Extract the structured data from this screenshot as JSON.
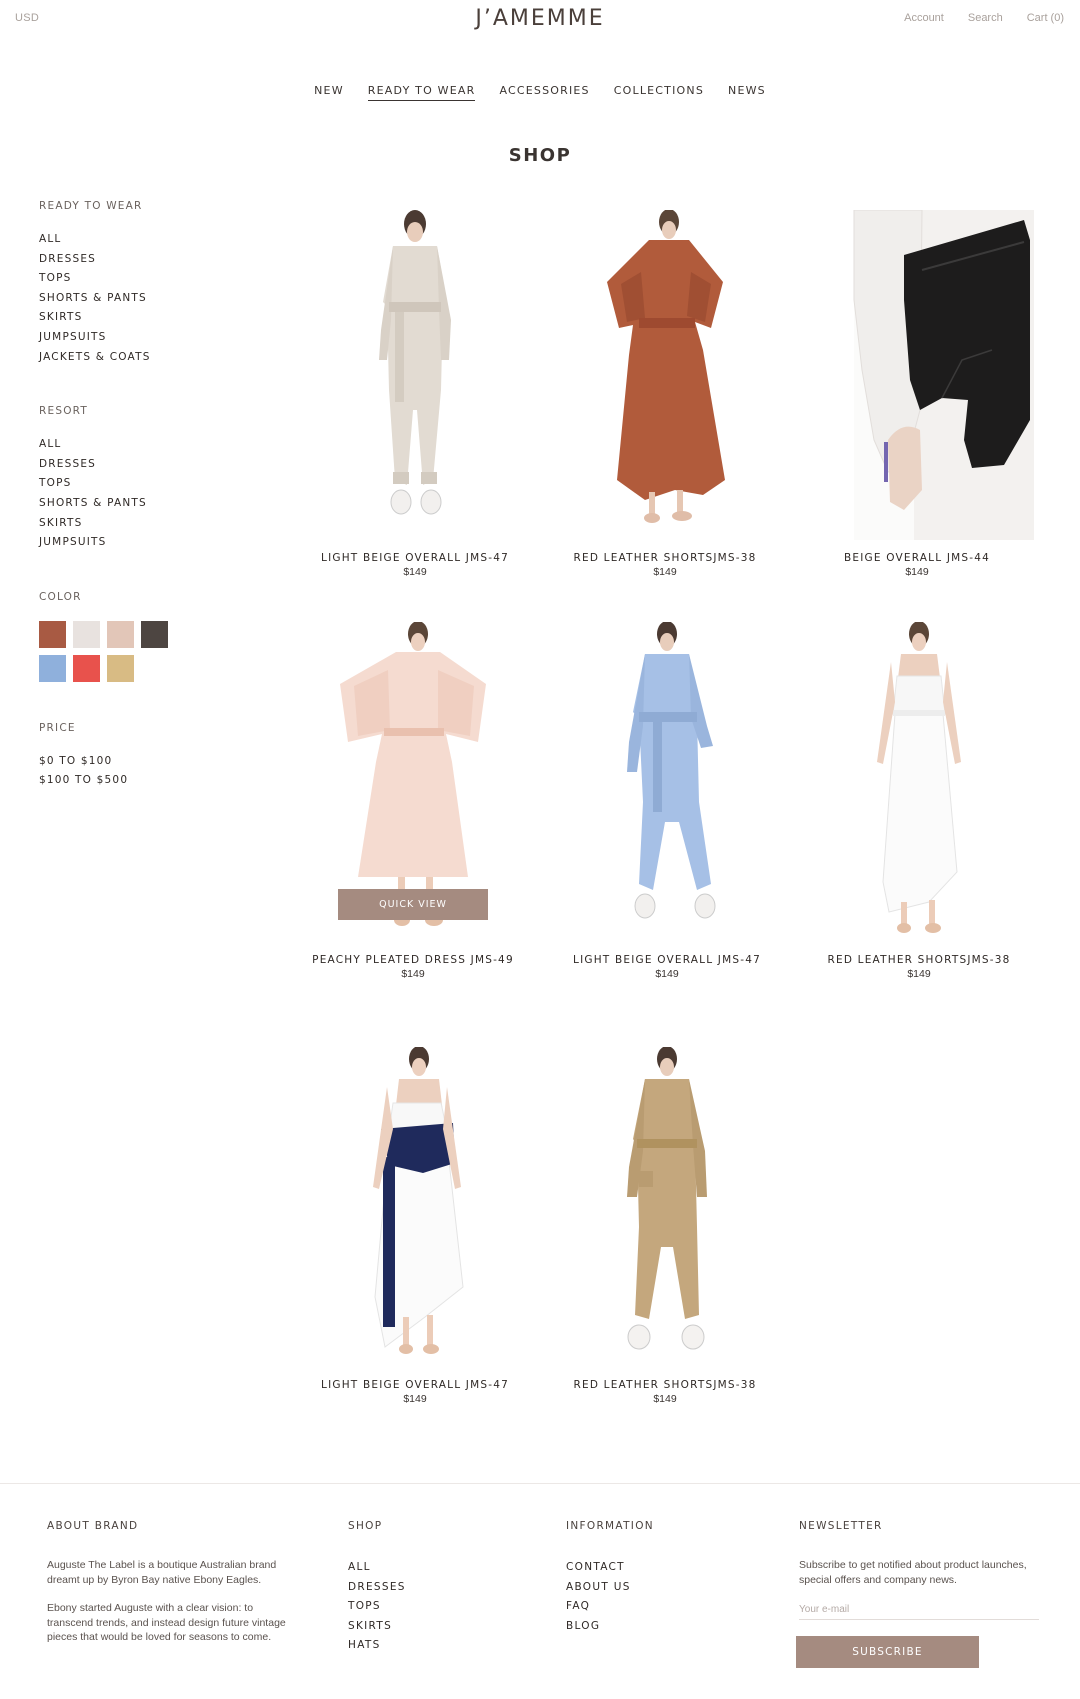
{
  "header": {
    "currency": "USD",
    "logo": "J’AMEMME",
    "links": {
      "account": "Account",
      "search": "Search",
      "cart": "Cart (0)"
    }
  },
  "nav": [
    "NEW",
    "READY TO WEAR",
    "ACCESSORIES",
    "COLLECTIONS",
    "NEWS"
  ],
  "nav_active": "READY TO WEAR",
  "page_title": "SHOP",
  "sidebar": {
    "ready_to_wear": {
      "heading": "READY TO WEAR",
      "items": [
        "ALL",
        "DRESSES",
        "TOPS",
        "SHORTS & PANTS",
        "SKIRTS",
        "JUMPSUITS",
        "JACKETS & COATS"
      ]
    },
    "resort": {
      "heading": "RESORT",
      "items": [
        "ALL",
        "DRESSES",
        "TOPS",
        "SHORTS & PANTS",
        "SKIRTS",
        "JUMPSUITS"
      ]
    },
    "color": {
      "heading": "COLOR",
      "swatches": [
        "#a85a43",
        "#e8e2df",
        "#e2c6b8",
        "#4d4541",
        "#8fb0dc",
        "#e8524c",
        "#d8bb84"
      ]
    },
    "price": {
      "heading": "PRICE",
      "items": [
        "$0 TO $100",
        "$100 TO $500"
      ]
    }
  },
  "products": [
    {
      "name": "LIGHT BEIGE OVERALL JMS-47",
      "price": "$149",
      "image": "beige-jumpsuit"
    },
    {
      "name": "RED LEATHER SHORTSJMS-38",
      "price": "$149",
      "image": "rust-pleated-dress"
    },
    {
      "name": "BEIGE OVERALL JMS-44",
      "price": "$149",
      "image": "black-leather-corset-closeup"
    },
    {
      "name": "PEACHY PLEATED DRESS JMS-49",
      "price": "$149",
      "image": "peach-pleated-dress",
      "quick_view": "QUICK VIEW"
    },
    {
      "name": "LIGHT BEIGE OVERALL JMS-47",
      "price": "$149",
      "image": "blue-jumpsuit"
    },
    {
      "name": "RED LEATHER SHORTSJMS-38",
      "price": "$149",
      "image": "white-camisole-pleated-skirt"
    },
    {
      "name": "LIGHT BEIGE OVERALL JMS-47",
      "price": "$149",
      "image": "white-dress-navy-belt"
    },
    {
      "name": "RED LEATHER SHORTSJMS-38",
      "price": "$149",
      "image": "khaki-jumpsuit"
    }
  ],
  "footer": {
    "about": {
      "heading": "ABOUT BRAND",
      "p1": "Auguste The Label is a boutique Australian brand dreamt up by Byron Bay native Ebony Eagles.",
      "p2": "Ebony started Auguste with a clear vision: to transcend trends, and instead design future vintage pieces that would be loved for seasons to come."
    },
    "shop": {
      "heading": "SHOP",
      "items": [
        "ALL",
        "DRESSES",
        "TOPS",
        "SKIRTS",
        "HATS"
      ]
    },
    "information": {
      "heading": "INFORMATION",
      "items": [
        "CONTACT",
        "ABOUT US",
        "FAQ",
        "BLOG"
      ]
    },
    "newsletter": {
      "heading": "NEWSLETTER",
      "text": "Subscribe to get notified about product launches, special offers and company news.",
      "placeholder": "Your e-mail",
      "button": "SUBSCRIBE"
    }
  }
}
